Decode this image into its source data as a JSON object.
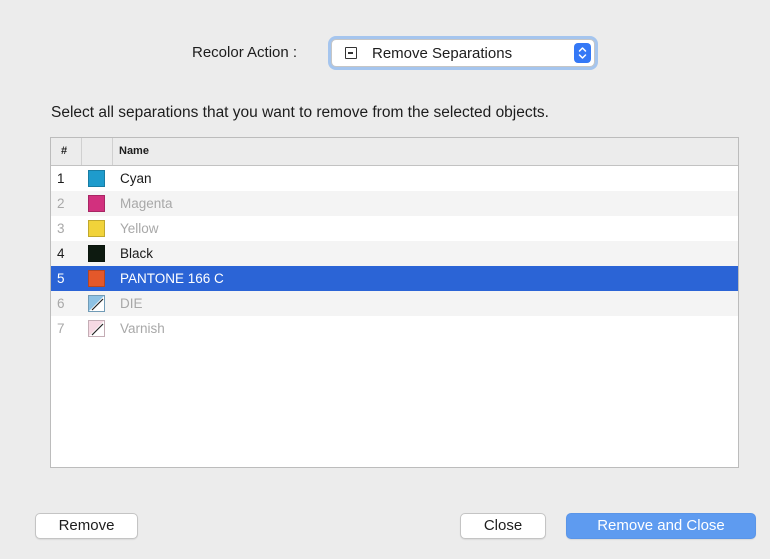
{
  "recolor_action": {
    "label": "Recolor Action :",
    "selected_value": "Remove Separations"
  },
  "instruction": "Select all separations that you want to remove from the selected objects.",
  "table": {
    "columns": [
      "#",
      "",
      "Name"
    ],
    "rows": [
      {
        "num": "1",
        "name": "Cyan",
        "color": "#1e9bcc",
        "enabled": true,
        "selected": false,
        "swatch_type": "solid"
      },
      {
        "num": "2",
        "name": "Magenta",
        "color": "#d2307e",
        "enabled": false,
        "selected": false,
        "swatch_type": "solid"
      },
      {
        "num": "3",
        "name": "Yellow",
        "color": "#f1d33a",
        "enabled": false,
        "selected": false,
        "swatch_type": "solid"
      },
      {
        "num": "4",
        "name": "Black",
        "color": "#0d1a10",
        "enabled": true,
        "selected": false,
        "swatch_type": "solid"
      },
      {
        "num": "5",
        "name": "PANTONE 166 C",
        "color": "#e4582a",
        "enabled": true,
        "selected": true,
        "swatch_type": "solid"
      },
      {
        "num": "6",
        "name": "DIE",
        "color": "#8ec2e4",
        "enabled": false,
        "selected": false,
        "swatch_type": "spot-special"
      },
      {
        "num": "7",
        "name": "Varnish",
        "color": "#f6d9e3",
        "enabled": false,
        "selected": false,
        "swatch_type": "spot-special"
      }
    ]
  },
  "buttons": {
    "remove": "Remove",
    "close": "Close",
    "remove_and_close": "Remove and Close"
  },
  "colors": {
    "selection": "#2b64d6",
    "primary_button": "#5e9bf0",
    "focus_ring": "#6ba6f0"
  }
}
